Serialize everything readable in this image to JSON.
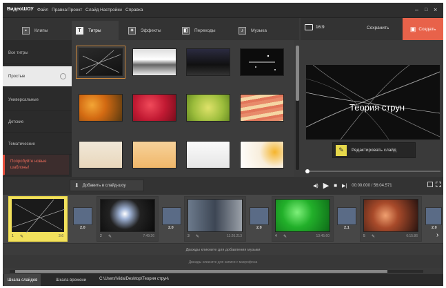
{
  "app": {
    "name": "ВидеоШОУ"
  },
  "menu": [
    "Файл",
    "Правка",
    "Проект",
    "Слайд",
    "Настройки",
    "Справка"
  ],
  "window_controls": {
    "minimize": "–",
    "maximize": "□",
    "close": "×"
  },
  "tabs": [
    {
      "label": "Клипы",
      "icon": "film-icon",
      "active": false
    },
    {
      "label": "Титры",
      "icon": "text-icon",
      "active": true
    },
    {
      "label": "Эффекты",
      "icon": "magic-icon",
      "active": false
    },
    {
      "label": "Переходы",
      "icon": "transition-icon",
      "active": false
    },
    {
      "label": "Музыка",
      "icon": "music-icon",
      "active": false
    }
  ],
  "categories": [
    {
      "label": "Все титры",
      "active": false,
      "highlight": false
    },
    {
      "label": "Простые",
      "active": true,
      "highlight": false
    },
    {
      "label": "Универсальные",
      "active": false,
      "highlight": false
    },
    {
      "label": "Детские",
      "active": false,
      "highlight": false
    },
    {
      "label": "Тематические",
      "active": false,
      "highlight": false
    },
    {
      "label": "Попробуйте новые шаблоны!",
      "active": false,
      "highlight": true
    }
  ],
  "preview_header": {
    "ratio": "16:9",
    "save": "Сохранить",
    "create": "Создать"
  },
  "preview": {
    "title_text": "Теория струн",
    "edit_label": "Редактировать слайд"
  },
  "add_button": {
    "label": "Добавить в слайд-шоу"
  },
  "playback": {
    "timecode": "00:00.000 / 56:04.571"
  },
  "timeline": {
    "slides": [
      {
        "num": "1",
        "duration": "3.6",
        "selected": true
      },
      {
        "num": "2",
        "duration": "7:49:26",
        "selected": false
      },
      {
        "num": "3",
        "duration": "11:26.213",
        "selected": false
      },
      {
        "num": "4",
        "duration": "13:45.60",
        "selected": false
      },
      {
        "num": "5",
        "duration": "6:15.86",
        "selected": false
      }
    ],
    "transitions": [
      "2.0",
      "2.0",
      "2.0",
      "2.1",
      "2.0"
    ],
    "music_hint": "Дважды кликните для добавления музыки",
    "voice_hint": "Дважды кликните для записи с микрофона"
  },
  "statusbar": {
    "tabs": [
      "Шкала слайдов",
      "Шкала времени"
    ],
    "path": "C:\\Users\\Vida\\Desktop\\Теория струн\\"
  },
  "colors": {
    "accent": "#e8624a",
    "selected_slide": "#f2e15c",
    "highlight_category": "#e86a5a"
  }
}
